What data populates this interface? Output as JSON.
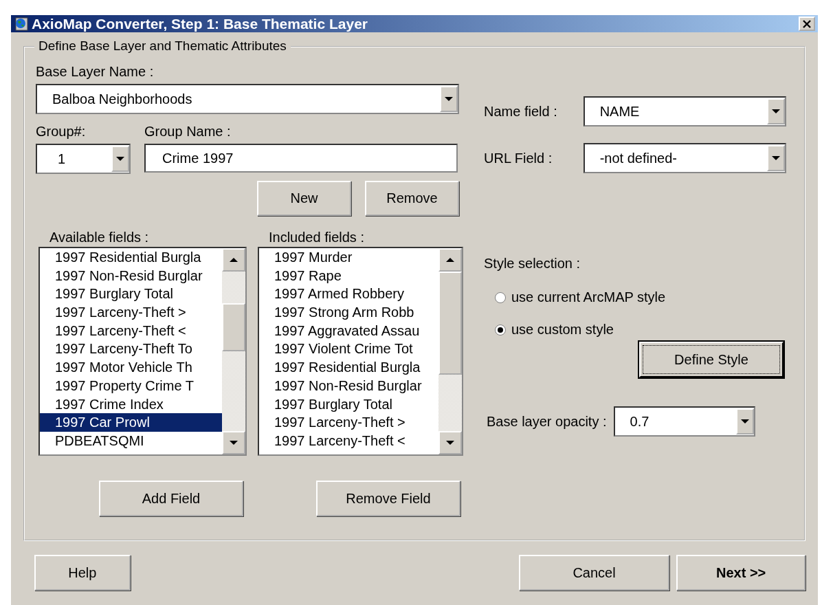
{
  "window": {
    "title": "AxioMap Converter, Step 1: Base Thematic Layer"
  },
  "group": {
    "legend": "Define Base Layer and Thematic Attributes"
  },
  "base_layer": {
    "label": "Base Layer Name :",
    "value": "Balboa Neighborhoods"
  },
  "group_number": {
    "label": "Group#:",
    "value": "1"
  },
  "group_name": {
    "label": "Group Name :",
    "value": "Crime 1997"
  },
  "group_buttons": [
    "New",
    "Remove"
  ],
  "available_fields": {
    "label": "Available fields :",
    "items": [
      {
        "text": "1997 Residential Burgla",
        "selected": false
      },
      {
        "text": "1997 Non-Resid Burglar",
        "selected": false
      },
      {
        "text": "1997 Burglary Total",
        "selected": false
      },
      {
        "text": "1997 Larceny-Theft >",
        "selected": false
      },
      {
        "text": "1997 Larceny-Theft <",
        "selected": false
      },
      {
        "text": "1997 Larceny-Theft To",
        "selected": false
      },
      {
        "text": "1997 Motor Vehicle Th",
        "selected": false
      },
      {
        "text": "1997 Property Crime T",
        "selected": false
      },
      {
        "text": "1997 Crime Index",
        "selected": false
      },
      {
        "text": "1997 Car Prowl",
        "selected": true
      },
      {
        "text": "PDBEATSQMI",
        "selected": false
      }
    ]
  },
  "included_fields": {
    "label": "Included fields :",
    "items": [
      {
        "text": "1997 Murder",
        "selected": false
      },
      {
        "text": "1997 Rape",
        "selected": false
      },
      {
        "text": "1997 Armed Robbery",
        "selected": false
      },
      {
        "text": "1997 Strong Arm Robb",
        "selected": false
      },
      {
        "text": "1997 Aggravated Assau",
        "selected": false
      },
      {
        "text": "1997 Violent Crime Tot",
        "selected": false
      },
      {
        "text": "1997 Residential Burgla",
        "selected": false
      },
      {
        "text": "1997 Non-Resid Burglar",
        "selected": false
      },
      {
        "text": "1997 Burglary Total",
        "selected": false
      },
      {
        "text": "1997 Larceny-Theft >",
        "selected": false
      },
      {
        "text": "1997 Larceny-Theft <",
        "selected": false
      }
    ]
  },
  "field_buttons": [
    "Add Field",
    "Remove Field"
  ],
  "name_field": {
    "label": "Name field :",
    "value": "NAME"
  },
  "url_field": {
    "label": "URL Field :",
    "value": "-not defined-"
  },
  "style_selection": {
    "label": "Style selection :",
    "options": [
      {
        "label": "use current ArcMAP style",
        "selected": false
      },
      {
        "label": "use custom style",
        "selected": true
      }
    ],
    "button": {
      "label": "Define Style",
      "focused": true
    }
  },
  "opacity": {
    "label": "Base layer opacity :",
    "value": "0.7"
  },
  "buttons": [
    {
      "label": "Help",
      "default": false
    },
    {
      "label": "Cancel",
      "default": false
    },
    {
      "label": "Next >>",
      "default": true
    }
  ]
}
